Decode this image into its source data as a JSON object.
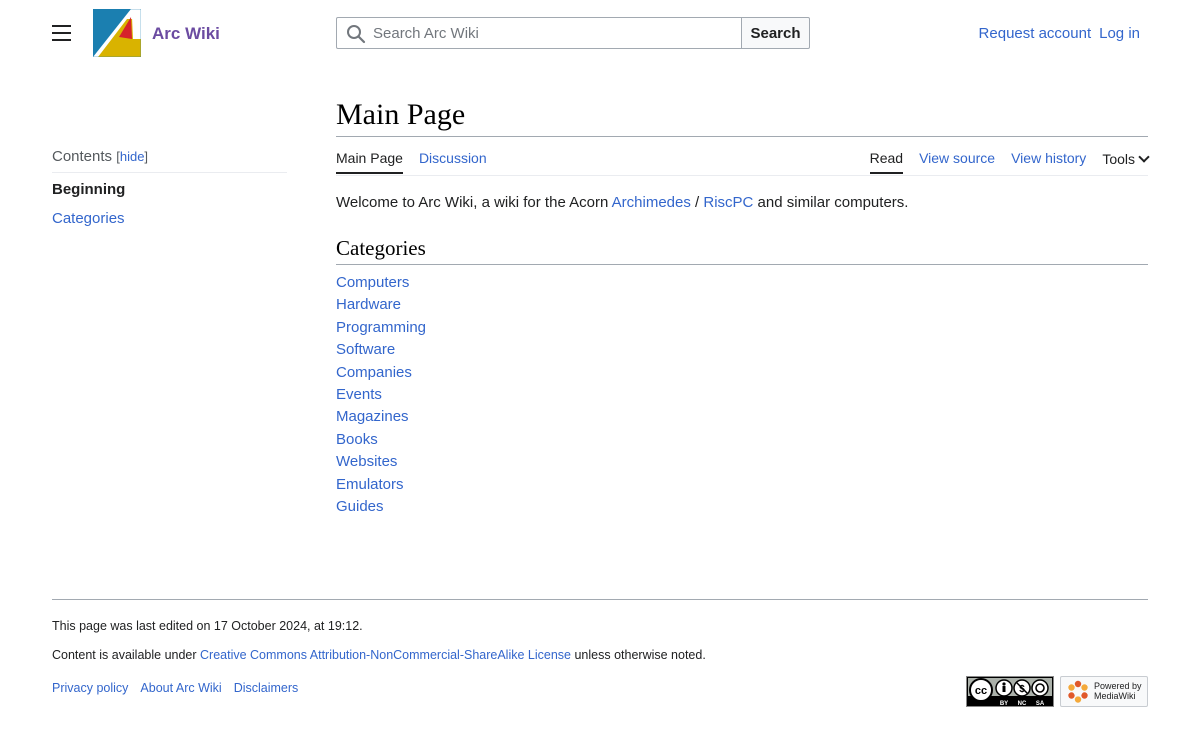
{
  "header": {
    "site_name": "Arc Wiki",
    "search": {
      "placeholder": "Search Arc Wiki",
      "button_label": "Search"
    },
    "user_links": [
      "Request account",
      "Log in"
    ]
  },
  "toc": {
    "title": "Contents",
    "hide_label": "hide",
    "items": [
      "Beginning",
      "Categories"
    ]
  },
  "page": {
    "title": "Main Page",
    "tabs_left": [
      "Main Page",
      "Discussion"
    ],
    "tabs_right": [
      "Read",
      "View source",
      "View history"
    ],
    "tools_label": "Tools",
    "intro": {
      "text_before": "Welcome to Arc Wiki, a wiki for the Acorn ",
      "link1": "Archimedes",
      "separator": " / ",
      "link2": "RiscPC",
      "text_after": " and similar computers."
    },
    "section_title": "Categories",
    "categories": [
      "Computers",
      "Hardware",
      "Programming",
      "Software",
      "Companies",
      "Events",
      "Magazines",
      "Books",
      "Websites",
      "Emulators",
      "Guides"
    ]
  },
  "footer": {
    "last_edited": "This page was last edited on 17 October 2024, at 19:12.",
    "license_before": "Content is available under ",
    "license_link": "Creative Commons Attribution-NonCommercial-ShareAlike License",
    "license_after": " unless otherwise noted.",
    "links": [
      "Privacy policy",
      "About Arc Wiki",
      "Disclaimers"
    ],
    "cc_badge_labels": [
      "BY",
      "NC",
      "SA"
    ],
    "powered_by_line1": "Powered by",
    "powered_by_line2": "MediaWiki"
  },
  "colors": {
    "link": "#3366cc",
    "wordmark": "#6b4ba1",
    "logo_blue": "#1b7fb0",
    "logo_red": "#d6232b",
    "logo_yellow": "#d9b300"
  }
}
